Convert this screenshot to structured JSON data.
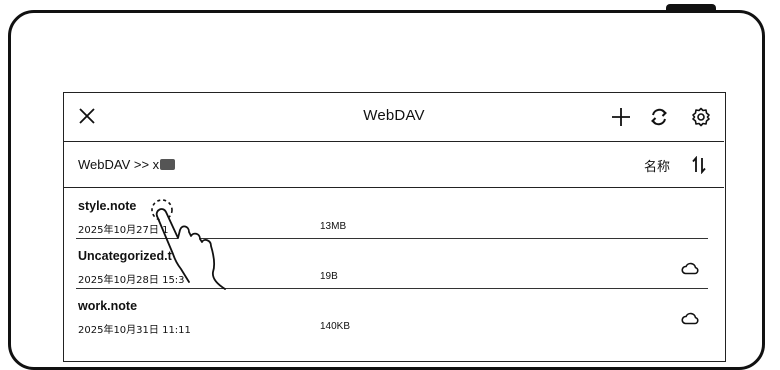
{
  "dialog": {
    "title": "WebDAV",
    "close_icon": "close-icon",
    "add_icon": "plus-icon",
    "sync_icon": "sync-icon",
    "settings_icon": "gear-icon"
  },
  "path": {
    "prefix": "WebDAV >> x",
    "sort_label": "名称",
    "sort_icon": "sort-arrows-icon"
  },
  "files": [
    {
      "name": "style.note",
      "date": "2025年10月27日 1",
      "size": "13MB",
      "cloud": false
    },
    {
      "name": "Uncategorized.t",
      "date": "2025年10月28日 15:3",
      "size": "19B",
      "cloud": true
    },
    {
      "name": "work.note",
      "date": "2025年10月31日 11:11",
      "size": "140KB",
      "cloud": true
    }
  ],
  "colors": {
    "ink": "#111111",
    "background": "#ffffff",
    "masked": "#555555"
  }
}
